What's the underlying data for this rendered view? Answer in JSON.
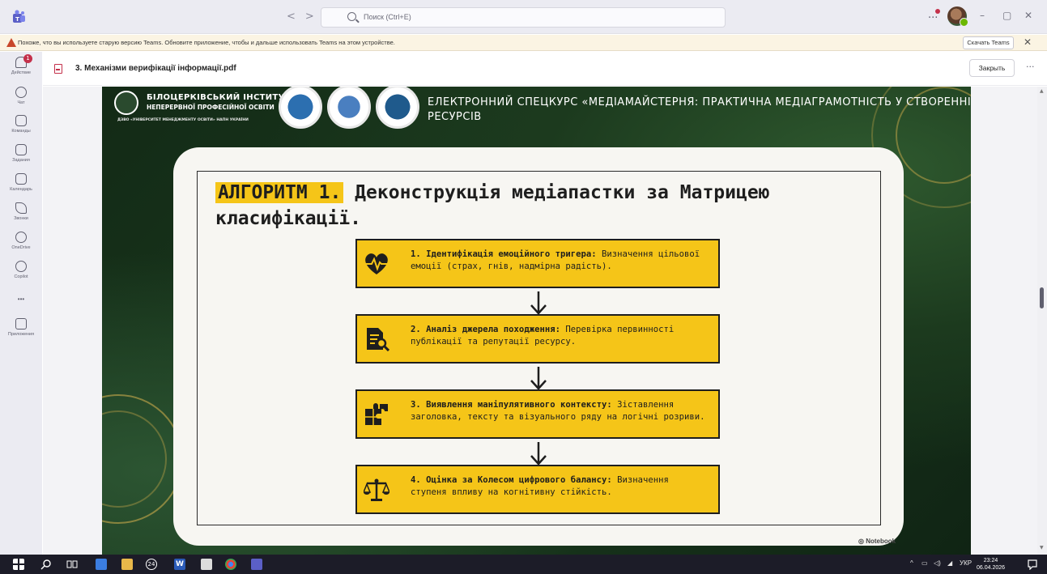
{
  "titlebar": {
    "search_placeholder": "Поиск (Ctrl+E)",
    "nav_back": "<",
    "nav_forward": ">",
    "more": "...",
    "minimize": "–",
    "restore": "▢",
    "close": "✕"
  },
  "banner": {
    "message": "Похоже, что вы используете старую версию Teams. Обновите приложение, чтобы и дальше использовать Teams на этом устройстве.",
    "download_label": "Скачать Teams",
    "close": "✕"
  },
  "rail": {
    "activity_badge": "1",
    "items": [
      {
        "label": "Действие",
        "icon": "bell-icon"
      },
      {
        "label": "Чат",
        "icon": "chat-icon"
      },
      {
        "label": "Команды",
        "icon": "teams-icon"
      },
      {
        "label": "Задания",
        "icon": "assignments-icon"
      },
      {
        "label": "Календарь",
        "icon": "calendar-icon"
      },
      {
        "label": "Звонки",
        "icon": "phone-icon"
      },
      {
        "label": "OneDrive",
        "icon": "cloud-icon"
      },
      {
        "label": "Copilot",
        "icon": "copilot-icon"
      },
      {
        "label": "•••",
        "icon": "more-icon"
      },
      {
        "label": "Приложения",
        "icon": "plus-icon"
      }
    ]
  },
  "document": {
    "title": "3. Механізми верифікації інформації.pdf",
    "close_label": "Закрыть",
    "more": "···"
  },
  "slide": {
    "institute_name": "БІЛОЦЕРКІВСЬКИЙ ІНСТИТУТ",
    "institute_sub": "НЕПЕРЕРВНОЇ ПРОФЕСІЙНОЇ ОСВІТИ",
    "institute_parent": "ДЗВО «УНІВЕРСИТЕТ МЕНЕДЖМЕНТУ ОСВІТИ» НАПН УКРАЇНИ",
    "course_title": "ЕЛЕКТРОННИЙ СПЕЦКУРС «МЕДІАМАЙСТЕРНЯ: ПРАКТИЧНА МЕДІАГРАМОТНІСТЬ У СТВОРЕННІ РЕСУРСІВ",
    "heading_highlight": "АЛГОРИТМ 1.",
    "heading_rest": " Деконструкція медіапастки за Матрицею класифікації.",
    "steps": [
      {
        "icon": "heartbeat-icon",
        "bold": "1. Ідентифікація емоційного тригера:",
        "text": " Визначення цільової емоції (страх, гнів, надмірна радість)."
      },
      {
        "icon": "document-search-icon",
        "bold": "2. Аналіз джерела походження:",
        "text": " Перевірка первинності публікації та репутації ресурсу."
      },
      {
        "icon": "puzzle-icon",
        "bold": "3. Виявлення маніпулятивного контексту:",
        "text": " Зіставлення заголовка, тексту та візуального ряду на логічні розриви."
      },
      {
        "icon": "scales-icon",
        "bold": "4. Оцінка за Колесом цифрового балансу:",
        "text": " Визначення ступеня впливу на когнітивну стійкість."
      }
    ],
    "brand": "Notebook"
  },
  "taskbar": {
    "badge_count": "24",
    "tray_lang": "УКР",
    "tray_expand": "^",
    "time": "23:24",
    "date": "06.04.2026"
  },
  "colors": {
    "accent_yellow": "#f5c518",
    "slide_green": "#1a3a1e",
    "teams_purple": "#5b5fc7",
    "alert_red": "#c4314b"
  }
}
